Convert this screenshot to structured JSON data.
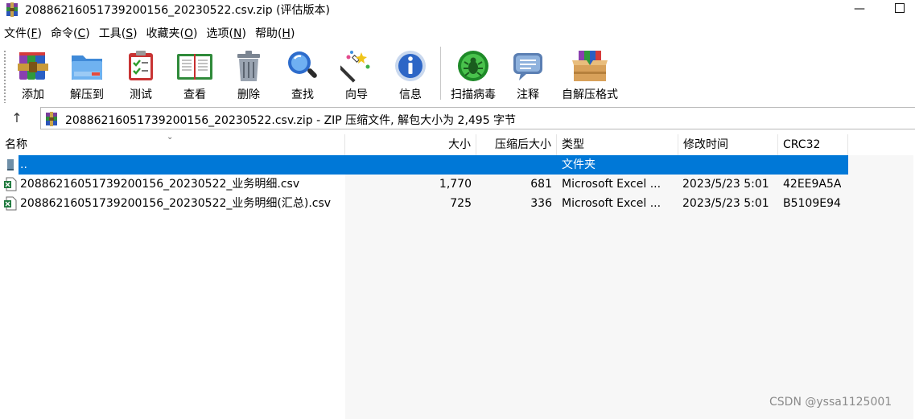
{
  "window": {
    "title": "20886216051739200156_20230522.csv.zip (评估版本)",
    "minimize_glyph": "—"
  },
  "menu": [
    {
      "label": "文件",
      "key": "F"
    },
    {
      "label": "命令",
      "key": "C"
    },
    {
      "label": "工具",
      "key": "S"
    },
    {
      "label": "收藏夹",
      "key": "O"
    },
    {
      "label": "选项",
      "key": "N"
    },
    {
      "label": "帮助",
      "key": "H"
    }
  ],
  "toolbar": {
    "add": "添加",
    "extract_to": "解压到",
    "test": "测试",
    "view": "查看",
    "delete": "删除",
    "find": "查找",
    "wizard": "向导",
    "info": "信息",
    "virus_scan": "扫描病毒",
    "comment": "注释",
    "sfx": "自解压格式"
  },
  "address": {
    "up_glyph": "↑",
    "text": "20886216051739200156_20230522.csv.zip - ZIP 压缩文件, 解包大小为 2,495 字节"
  },
  "columns": {
    "name": "名称",
    "size": "大小",
    "packed": "压缩后大小",
    "type": "类型",
    "modified": "修改时间",
    "crc": "CRC32",
    "sort_glyph": "⌄"
  },
  "rows": [
    {
      "name": "..",
      "size": "",
      "packed": "",
      "type": "文件夹",
      "modified": "",
      "crc": ""
    },
    {
      "name": "20886216051739200156_20230522_业务明细.csv",
      "size": "1,770",
      "packed": "681",
      "type": "Microsoft Excel ...",
      "modified": "2023/5/23 5:01",
      "crc": "42EE9A5A"
    },
    {
      "name": "20886216051739200156_20230522_业务明细(汇总).csv",
      "size": "725",
      "packed": "336",
      "type": "Microsoft Excel ...",
      "modified": "2023/5/23 5:01",
      "crc": "B5109E94"
    }
  ],
  "watermark": "CSDN @yssa1125001",
  "colors": {
    "selection": "#0078d7",
    "accent_green": "#2e9e2e"
  }
}
